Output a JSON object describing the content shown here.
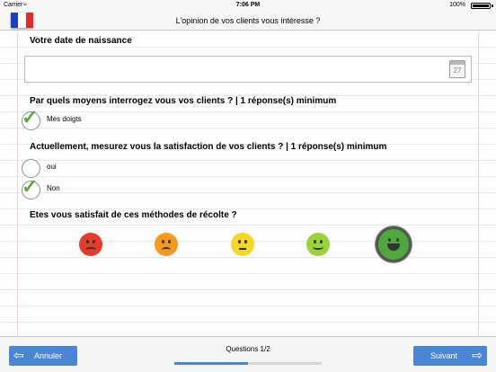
{
  "status_bar": {
    "carrier": "Carrier",
    "time": "7:06 PM",
    "battery": "100%",
    "wifi_icon": "wifi-icon",
    "battery_icon": "battery-icon"
  },
  "nav": {
    "title": "L'opinion de vos clients vous intéresse ?",
    "flag_icon": "french-flag-icon",
    "flag_colors": [
      "#1f3fbf",
      "#ffffff",
      "#e12a2a"
    ]
  },
  "questions": {
    "birthdate": {
      "title": "Votre date de naissance",
      "value": "",
      "calendar_label": "27"
    },
    "methods": {
      "title": "Par quels moyens interrogez vous vos clients ? | 1 réponse(s) minimum",
      "options": [
        {
          "label": "Mes doigts",
          "checked": true
        }
      ]
    },
    "measure": {
      "title": "Actuellement, mesurez vous la satisfaction de vos clients ? | 1 réponse(s) minimum",
      "options": [
        {
          "label": "oui",
          "checked": false
        },
        {
          "label": "Non",
          "checked": true
        }
      ]
    },
    "satisfaction": {
      "title": "Etes vous satisfait de ces méthodes de récolte ?",
      "options": [
        {
          "icon": "very-unhappy-face-icon",
          "color": "#e53b2c",
          "selected": false
        },
        {
          "icon": "unhappy-face-icon",
          "color": "#f39a1f",
          "selected": false
        },
        {
          "icon": "neutral-face-icon",
          "color": "#f5d62b",
          "selected": false
        },
        {
          "icon": "happy-face-icon",
          "color": "#9bd13a",
          "selected": false
        },
        {
          "icon": "very-happy-face-icon",
          "color": "#4fa83c",
          "selected": true
        }
      ]
    }
  },
  "footer": {
    "prev_label": "Annuler",
    "next_label": "Suivant",
    "progress_label": "Questions 1/2",
    "progress": 0.5,
    "accent": "#4a86d4"
  }
}
